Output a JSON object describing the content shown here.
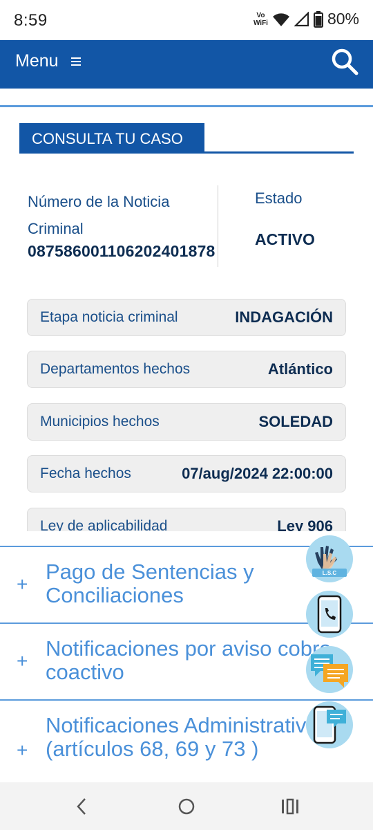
{
  "status_bar": {
    "time": "8:59",
    "network_line1": "Vo",
    "network_line2": "WiFi",
    "battery": "80%"
  },
  "header": {
    "menu_label": "Menu",
    "menu_icon": "hamburger-icon",
    "search_icon": "search-icon",
    "background": "#1256a6"
  },
  "case": {
    "title": "CONSULTA TU CASO",
    "noticia_label": "Número de la Noticia Criminal",
    "noticia_number": "087586001106202401878",
    "estado_label": "Estado",
    "estado_value": "ACTIVO",
    "details": [
      {
        "label": "Etapa noticia criminal",
        "value": "INDAGACIÓN"
      },
      {
        "label": "Departamentos hechos",
        "value": "Atlántico"
      },
      {
        "label": "Municipios hechos",
        "value": "SOLEDAD"
      },
      {
        "label": "Fecha hechos",
        "value": "07/aug/2024 22:00:00"
      },
      {
        "label": "Ley de aplicabilidad",
        "value": "Ley 906"
      }
    ]
  },
  "accordion": [
    {
      "icon": "+",
      "label": "Pago de Sentencias y Conciliaciones"
    },
    {
      "icon": "+",
      "label": "Notificaciones por aviso cobro coactivo"
    },
    {
      "icon": "+",
      "label": "Notificaciones Administrativas (artículos 68, 69 y 73 )"
    }
  ],
  "floating_buttons": [
    {
      "icon": "sign-language-icon",
      "caption": "L.S.C"
    },
    {
      "icon": "phone-icon"
    },
    {
      "icon": "chat-icon"
    },
    {
      "icon": "mobile-chat-icon"
    }
  ],
  "nav": {
    "back_icon": "back-icon",
    "home_icon": "home-icon",
    "recents_icon": "recents-icon"
  }
}
